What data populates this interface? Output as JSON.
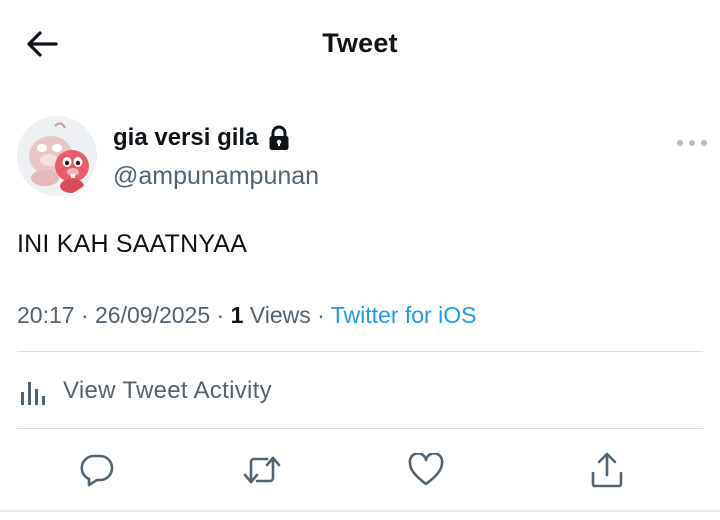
{
  "header": {
    "title": "Tweet",
    "back_icon": "arrow-left-icon"
  },
  "author": {
    "display_name": "gia versi gila",
    "protected_icon": "lock-icon",
    "handle": "@ampunampunan",
    "avatar_icon": "beaver-avatar-icon",
    "more_icon": "more-horizontal-icon"
  },
  "tweet": {
    "text": "INI KAH SAATNYAA"
  },
  "meta": {
    "time": "20:17",
    "separator": " · ",
    "date": "26/09/2025",
    "views_count": "1",
    "views_label": "Views",
    "source": "Twitter for iOS"
  },
  "activity": {
    "label": "View Tweet Activity",
    "icon": "bar-chart-icon"
  },
  "actions": {
    "reply_icon": "reply-icon",
    "retweet_icon": "retweet-icon",
    "like_icon": "heart-icon",
    "share_icon": "share-icon"
  },
  "colors": {
    "text": "#0f1419",
    "secondary": "#536471",
    "link": "#1d9bf0",
    "divider": "#d9dde1"
  }
}
